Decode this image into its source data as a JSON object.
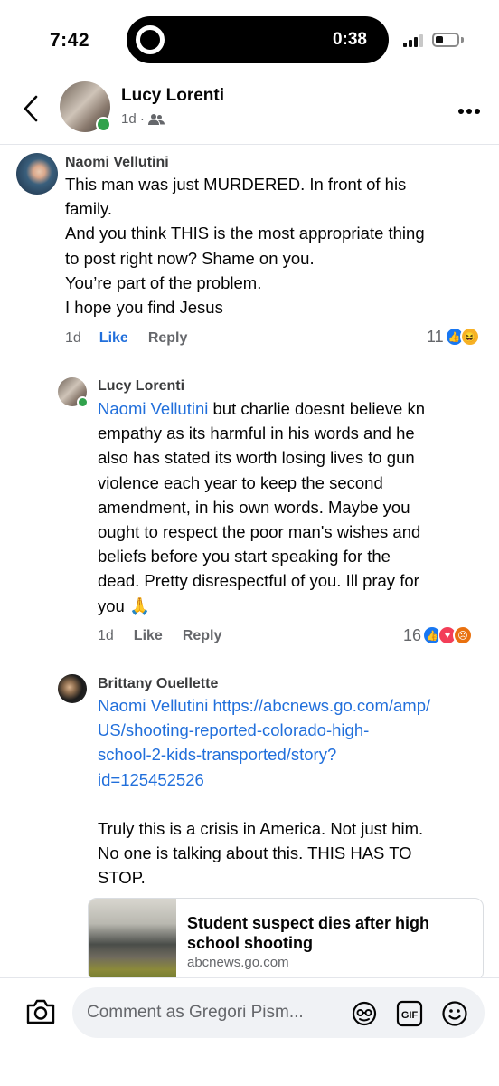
{
  "status_bar": {
    "time": "7:42",
    "activity_timer": "0:38"
  },
  "header": {
    "name": "Lucy Lorenti",
    "meta": "1d ·",
    "audience_icon": "friends-icon"
  },
  "comments": [
    {
      "author": "Naomi Vellutini",
      "lines": [
        "This man was just MURDERED. In front of his",
        "family.",
        "And you think THIS is the most appropriate thing",
        "to post right now? Shame on you.",
        "You’re part of the problem.",
        "I hope you find Jesus"
      ],
      "time": "1d",
      "like_label": "Like",
      "reply_label": "Reply",
      "reaction_count": "11",
      "reactions": [
        "like",
        "haha"
      ]
    },
    {
      "author": "Lucy Lorenti",
      "mention": "Naomi Vellutini",
      "first_line_rest": " but charlie doesnt believe kn",
      "lines": [
        "empathy as its harmful in his words and he",
        "also has stated its worth losing lives to gun",
        "violence each year to keep the second",
        "amendment, in his own words. Maybe you",
        "ought to respect the poor man's wishes and",
        "beliefs before you start speaking for the",
        "dead. Pretty disrespectful of you. Ill pray for",
        "you 🙏"
      ],
      "time": "1d",
      "like_label": "Like",
      "reply_label": "Reply",
      "reaction_count": "16",
      "reactions": [
        "like",
        "love",
        "angry"
      ]
    },
    {
      "author": "Brittany Ouellette",
      "mention": "Naomi Vellutini",
      "link_lines": [
        " https://abcnews.go.com/amp/",
        "US/shooting-reported-colorado-high-",
        "school-2-kids-transported/story?",
        "id=125452526"
      ],
      "lines": [
        "Truly this is a crisis in America. Not just him.",
        "No one is talking about this. THIS HAS TO",
        "STOP."
      ]
    }
  ],
  "link_preview": {
    "title": "Student suspect dies after high school shooting",
    "domain": "abcnews.go.com"
  },
  "composer": {
    "placeholder": "Comment as Gregori Pism..."
  },
  "colors": {
    "link_blue": "#216fdb",
    "like_blue": "#1877f2",
    "online_green": "#31a24c",
    "secondary_text": "#65676b"
  }
}
